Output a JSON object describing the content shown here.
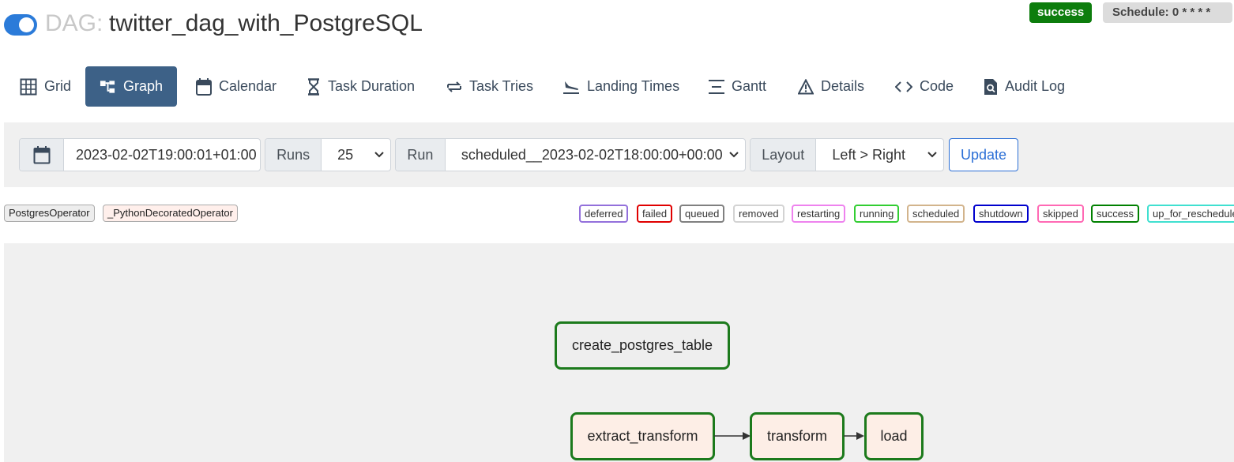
{
  "header": {
    "dag_prefix": "DAG:",
    "dag_name": "twitter_dag_with_PostgreSQL",
    "toggle_on": true,
    "status_badge": "success",
    "schedule_badge": "Schedule: 0 * * * *"
  },
  "nav": {
    "tabs": [
      {
        "label": "Grid",
        "icon": "grid-icon"
      },
      {
        "label": "Graph",
        "icon": "graph-icon",
        "active": true
      },
      {
        "label": "Calendar",
        "icon": "calendar-icon"
      },
      {
        "label": "Task Duration",
        "icon": "hourglass-icon"
      },
      {
        "label": "Task Tries",
        "icon": "retry-icon"
      },
      {
        "label": "Landing Times",
        "icon": "plane-landing-icon"
      },
      {
        "label": "Gantt",
        "icon": "gantt-icon"
      },
      {
        "label": "Details",
        "icon": "warning-triangle-icon"
      },
      {
        "label": "Code",
        "icon": "code-icon"
      },
      {
        "label": "Audit Log",
        "icon": "file-search-icon"
      }
    ]
  },
  "filters": {
    "base_date": "2023-02-02T19:00:01+01:00",
    "runs_label": "Runs",
    "runs_value": "25",
    "run_label": "Run",
    "run_value": "scheduled__2023-02-02T18:00:00+00:00",
    "layout_label": "Layout",
    "layout_value": "Left > Right",
    "update_label": "Update"
  },
  "legend": {
    "operators": [
      {
        "label": "PostgresOperator",
        "color": "#ededed"
      },
      {
        "label": "_PythonDecoratedOperator",
        "color": "#ffefeb"
      }
    ],
    "states": [
      {
        "label": "deferred",
        "color": "#9370db"
      },
      {
        "label": "failed",
        "color": "#e00000"
      },
      {
        "label": "queued",
        "color": "#808080"
      },
      {
        "label": "removed",
        "color": "#d3d3d3"
      },
      {
        "label": "restarting",
        "color": "#ee82ee"
      },
      {
        "label": "running",
        "color": "#32cd32"
      },
      {
        "label": "scheduled",
        "color": "#d2b48c"
      },
      {
        "label": "shutdown",
        "color": "#0000cd"
      },
      {
        "label": "skipped",
        "color": "#ff69b4"
      },
      {
        "label": "success",
        "color": "#008000"
      },
      {
        "label": "up_for_reschedule",
        "color": "#40e0d0"
      }
    ]
  },
  "graph": {
    "nodes": [
      {
        "id": "create_postgres_table",
        "label": "create_postgres_table",
        "operator": "PostgresOperator",
        "state": "success"
      },
      {
        "id": "extract_transform",
        "label": "extract_transform",
        "operator": "_PythonDecoratedOperator",
        "state": "success"
      },
      {
        "id": "transform",
        "label": "transform",
        "operator": "_PythonDecoratedOperator",
        "state": "success"
      },
      {
        "id": "load",
        "label": "load",
        "operator": "_PythonDecoratedOperator",
        "state": "success"
      }
    ],
    "edges": [
      {
        "from": "extract_transform",
        "to": "transform"
      },
      {
        "from": "transform",
        "to": "load"
      }
    ]
  }
}
